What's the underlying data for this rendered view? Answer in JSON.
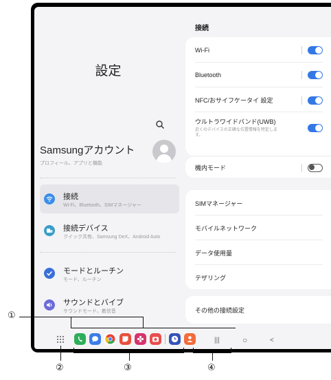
{
  "left": {
    "title": "設定",
    "search_icon": "search-icon",
    "account": {
      "name": "Samsungアカウント",
      "sub": "プロフィール、アプリと機能"
    },
    "menu": [
      {
        "label": "接続",
        "sub": "Wi-Fi、Bluetooth、SIMマネージャー",
        "icon": "wifi-icon",
        "color": "#3b8ee8",
        "active": true
      },
      {
        "label": "接続デバイス",
        "sub": "クイック共有、Samsung DeX、Android Auto",
        "icon": "devices-icon",
        "color": "#3a9ec8"
      },
      {
        "label": "モードとルーチン",
        "sub": "モード、ルーチン",
        "icon": "modes-icon",
        "color": "#3b6fd8"
      },
      {
        "label": "サウンドとバイブ",
        "sub": "サウンドモード、着信音",
        "icon": "sound-icon",
        "color": "#6b6bd9"
      }
    ]
  },
  "right": {
    "section_title": "接続",
    "wifi": "Wi-Fi",
    "bluetooth": "Bluetooth",
    "nfc": "NFC/おサイフケータイ 設定",
    "uwb": "ウルトラワイドバンド(UWB)",
    "uwb_desc": "近くのデバイスの正確な位置情報を特定します。",
    "airplane": "機内モード",
    "sim": "SIMマネージャー",
    "mobile_network": "モバイルネットワーク",
    "data_usage": "データ使用量",
    "tethering": "テザリング",
    "other": "その他の接続設定"
  },
  "taskbar": {
    "apps": [
      {
        "name": "phone-app-icon",
        "color": "#2eae5a"
      },
      {
        "name": "messages-app-icon",
        "color": "#3c7ee8"
      },
      {
        "name": "chrome-app-icon",
        "color": "#ffffff"
      },
      {
        "name": "notes-app-icon",
        "color": "#e84f3c"
      },
      {
        "name": "gallery-app-icon",
        "color": "#d6336c"
      },
      {
        "name": "camera-app-icon",
        "color": "#e84f4f"
      },
      {
        "name": "clock-app-icon",
        "color": "#3552b8"
      },
      {
        "name": "contacts-app-icon",
        "color": "#f26c3c"
      }
    ],
    "nav": {
      "recent": "|||",
      "home": "○",
      "back": "<"
    }
  },
  "callouts": [
    "①",
    "②",
    "③",
    "④"
  ]
}
